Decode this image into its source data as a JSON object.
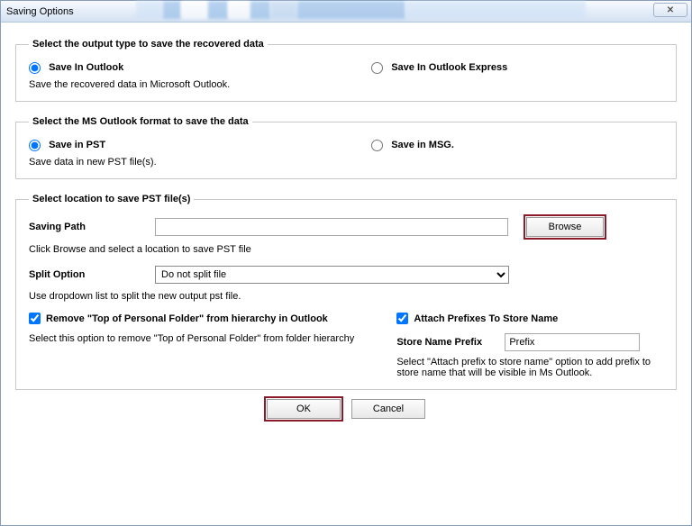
{
  "window": {
    "title": "Saving Options"
  },
  "group1": {
    "legend": "Select the output type to save the recovered data",
    "opt1": "Save In Outlook",
    "opt2": "Save In Outlook Express",
    "help": "Save the recovered data in Microsoft Outlook."
  },
  "group2": {
    "legend": "Select the MS Outlook format to save the data",
    "opt1": "Save in PST",
    "opt2": "Save in MSG.",
    "help": "Save data in new PST file(s)."
  },
  "group3": {
    "legend": "Select location to save PST file(s)",
    "pathLabel": "Saving Path",
    "pathValue": "",
    "browse": "Browse",
    "pathHelp": "Click Browse and select a location to save PST file",
    "splitLabel": "Split Option",
    "splitValue": "Do not split file",
    "splitHelp": "Use dropdown list to split the new output pst file.",
    "removeTop": "Remove \"Top of Personal Folder\" from hierarchy in Outlook",
    "removeTopHelp": "Select this option to remove \"Top of Personal Folder\" from folder hierarchy",
    "attachPrefix": "Attach Prefixes To Store Name",
    "storeNamePrefixLabel": "Store Name Prefix",
    "storeNamePrefixValue": "Prefix",
    "storeNamePrefixHelp": "Select \"Attach prefix to store name\" option to add prefix to store name that will be visible in Ms Outlook."
  },
  "footer": {
    "ok": "OK",
    "cancel": "Cancel"
  }
}
